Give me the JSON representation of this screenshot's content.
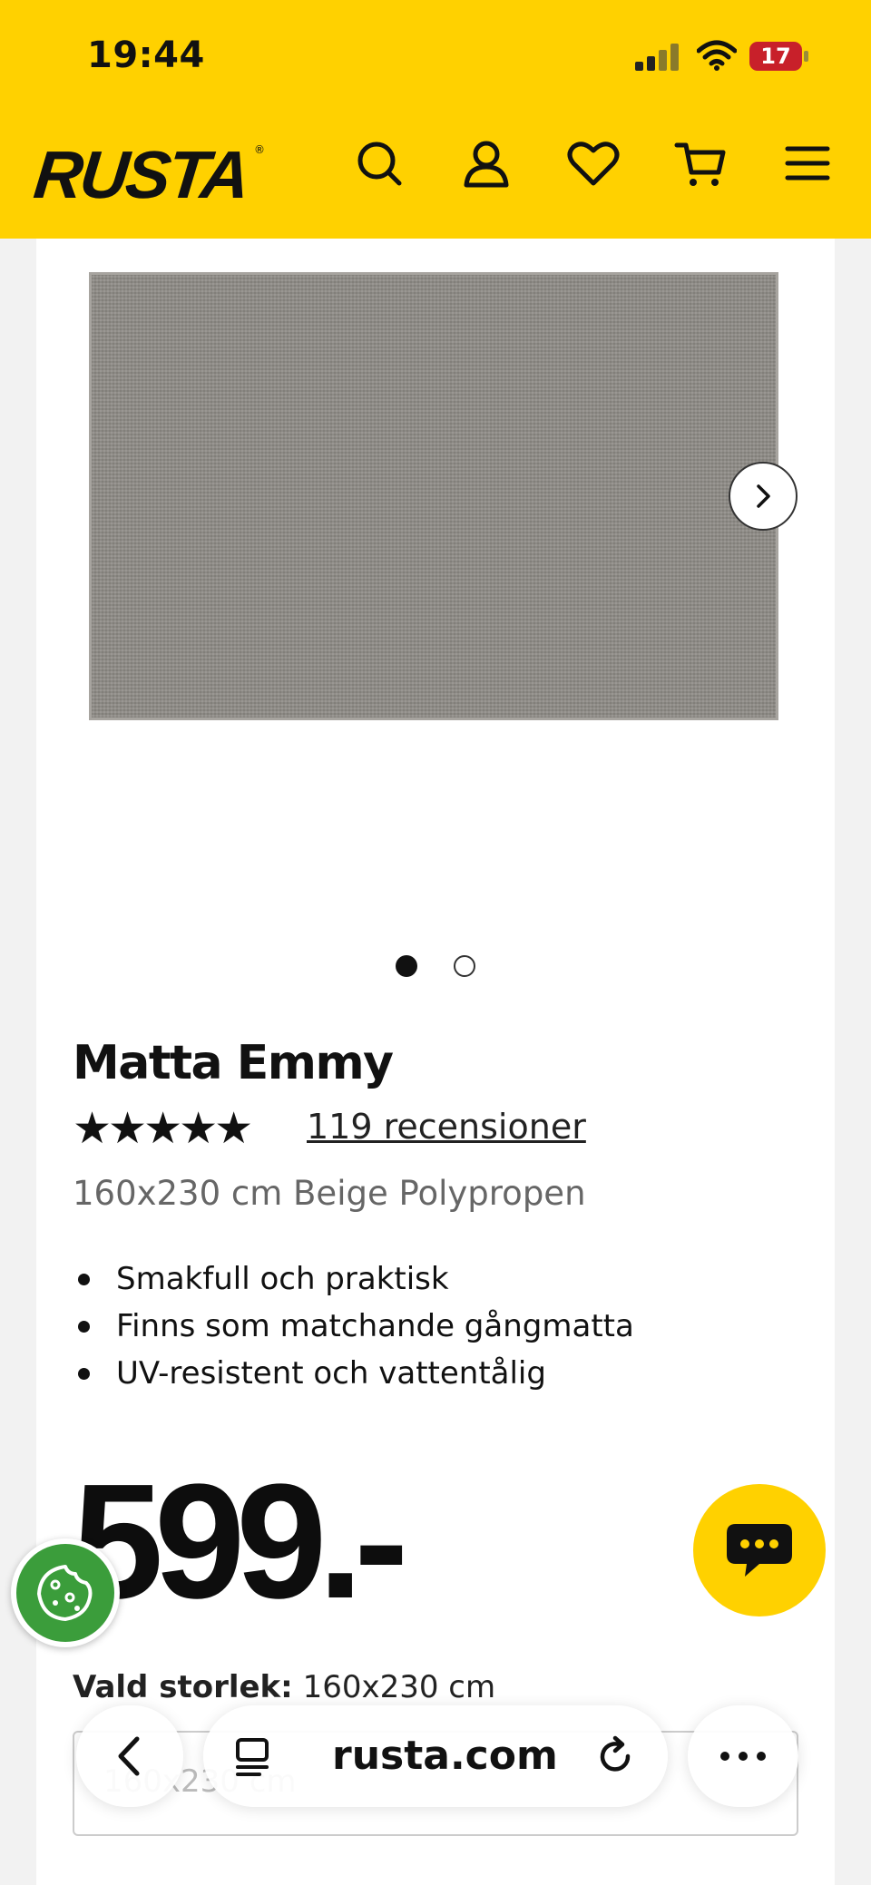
{
  "status_bar": {
    "time": "19:44",
    "battery": "17"
  },
  "header": {
    "logo": "RUSTA",
    "logo_mark": "®"
  },
  "product": {
    "title": "Matta Emmy",
    "rating_stars": "★★★★★",
    "reviews_link": "119 recensioner",
    "subtitle": "160x230 cm Beige Polypropen",
    "bullets": [
      "Smakfull och praktisk",
      "Finns som matchande gångmatta",
      "UV-resistent och vattentålig"
    ],
    "price": "599.-",
    "selected_size_label": "Vald storlek:",
    "selected_size_value": "160x230 cm",
    "size_select_value": "160x230 cm"
  },
  "browser": {
    "url": "rusta.com"
  },
  "colors": {
    "brand_yellow": "#ffd100",
    "cookie_green": "#3b9d3b"
  }
}
